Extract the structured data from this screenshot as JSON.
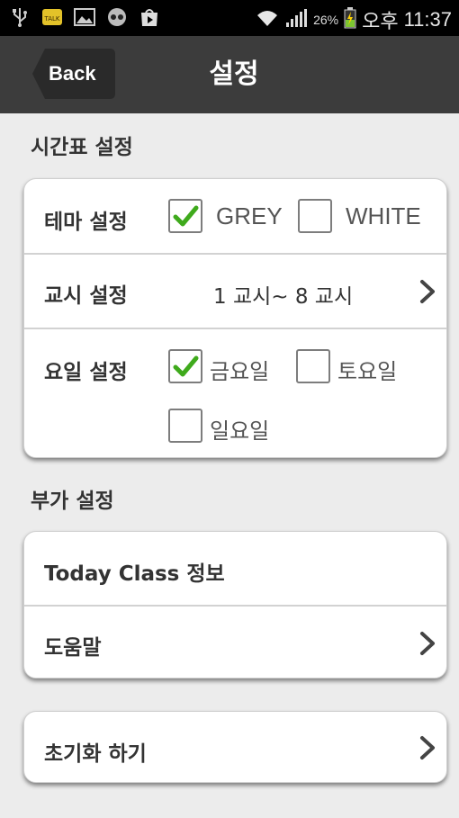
{
  "status_bar": {
    "battery": "26%",
    "ampm": "오후",
    "time": "11:37",
    "icons": [
      "usb-icon",
      "kakaotalk-icon",
      "gallery-icon",
      "blind-icon",
      "play-store-icon",
      "wifi-icon",
      "signal-icon",
      "battery-charging-icon"
    ]
  },
  "header": {
    "back_label": "Back",
    "title": "설정"
  },
  "timetable_section": {
    "title": "시간표 설정",
    "theme": {
      "label": "테마 설정",
      "options": [
        {
          "label": "GREY",
          "checked": true
        },
        {
          "label": "WHITE",
          "checked": false
        }
      ]
    },
    "period": {
      "label": "교시 설정",
      "value": "1 교시~ 8 교시"
    },
    "days": {
      "label": "요일 설정",
      "options": [
        {
          "label": "금요일",
          "checked": true
        },
        {
          "label": "토요일",
          "checked": false
        },
        {
          "label": "일요일",
          "checked": false
        }
      ]
    }
  },
  "extra_section": {
    "title": "부가 설정",
    "items": [
      "Today Class 정보",
      "도움말"
    ]
  },
  "reset": {
    "label": "초기화 하기"
  },
  "colors": {
    "action_bar": "#3c3c3c",
    "background": "#ececec",
    "check_green": "#3faa1c"
  }
}
